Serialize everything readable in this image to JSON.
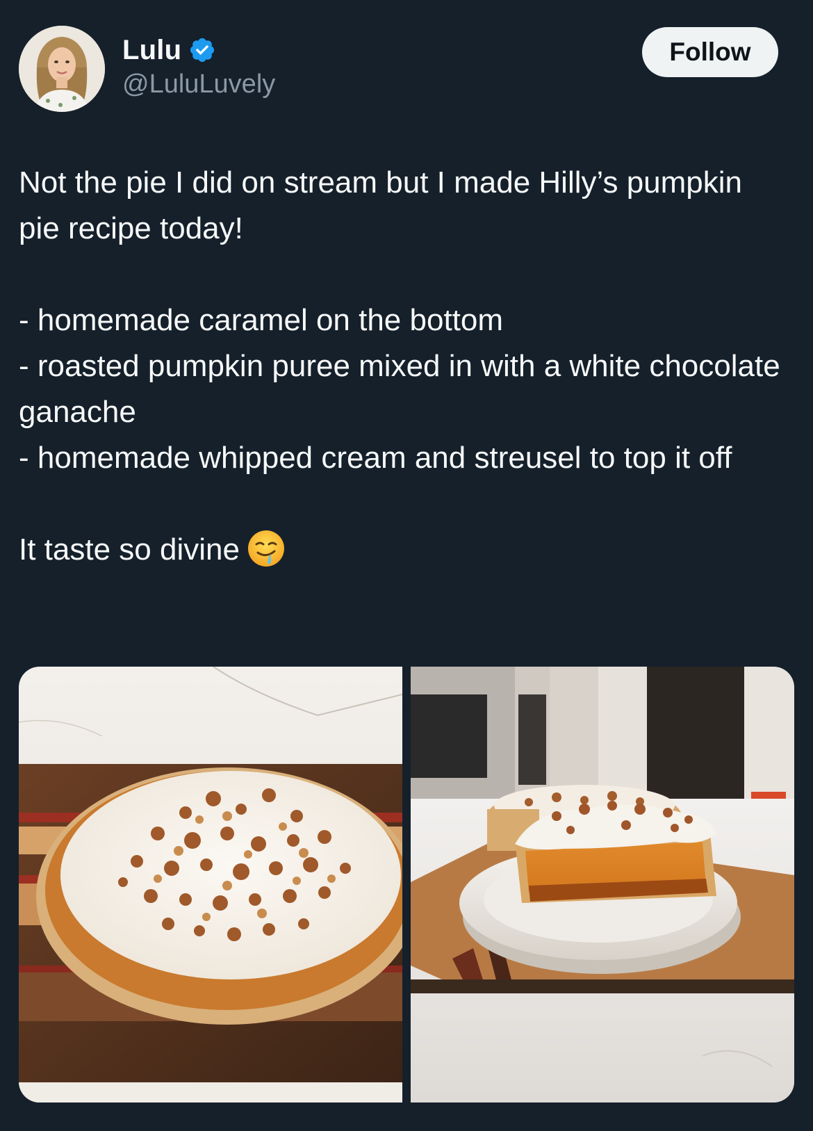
{
  "author": {
    "display_name": "Lulu",
    "handle": "@LuluLuvely",
    "verified": true,
    "avatar_icon": "profile-photo"
  },
  "follow_button": {
    "label": "Follow"
  },
  "tweet": {
    "paragraph_1": "Not the pie I did on stream but I made Hilly’s pumpkin pie recipe today!",
    "bullet_1": "- homemade caramel on the bottom",
    "bullet_2": "- roasted pumpkin puree mixed in with a white chocolate ganache",
    "bullet_3": "- homemade whipped cream and streusel to top it off",
    "closing": "It taste so divine",
    "closing_emoji": "drooling-face"
  },
  "media": {
    "photos": [
      {
        "icon": "pumpkin-pie-whole-photo"
      },
      {
        "icon": "pumpkin-pie-slice-photo"
      }
    ]
  },
  "colors": {
    "background": "#15202b",
    "text": "#f7f9f9",
    "secondary_text": "#8b98a5",
    "verified_badge": "#1d9bf0",
    "follow_button_bg": "#eff3f4"
  }
}
